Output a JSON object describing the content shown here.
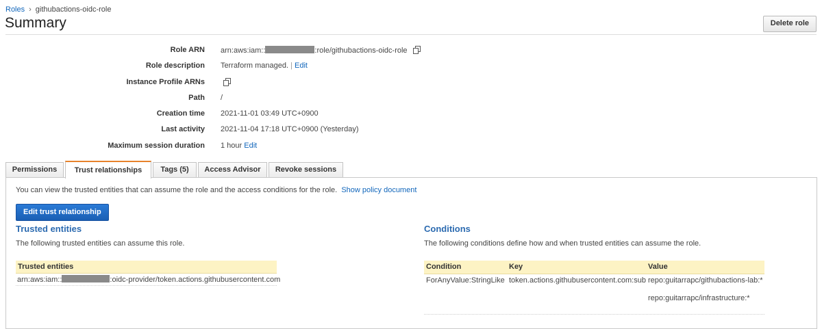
{
  "breadcrumb": {
    "root": "Roles",
    "separator": "›",
    "current": "githubactions-oidc-role"
  },
  "page_title": "Summary",
  "delete_button": "Delete role",
  "summary": {
    "role_arn": {
      "label": "Role ARN",
      "prefix": "arn:aws:iam::",
      "suffix": ":role/githubactions-oidc-role"
    },
    "role_description": {
      "label": "Role description",
      "value": "Terraform managed.",
      "divider": "|",
      "edit": "Edit"
    },
    "instance_profile": {
      "label": "Instance Profile ARNs"
    },
    "path": {
      "label": "Path",
      "value": "/"
    },
    "creation_time": {
      "label": "Creation time",
      "value": "2021-11-01 03:49 UTC+0900"
    },
    "last_activity": {
      "label": "Last activity",
      "value": "2021-11-04 17:18 UTC+0900 (Yesterday)"
    },
    "max_session": {
      "label": "Maximum session duration",
      "value": "1 hour",
      "edit": "Edit"
    }
  },
  "tabs": [
    {
      "label": "Permissions",
      "active": false
    },
    {
      "label": "Trust relationships",
      "active": true
    },
    {
      "label": "Tags (5)",
      "active": false
    },
    {
      "label": "Access Advisor",
      "active": false
    },
    {
      "label": "Revoke sessions",
      "active": false
    }
  ],
  "trust": {
    "intro": "You can view the trusted entities that can assume the role and the access conditions for the role.",
    "show_policy": "Show policy document",
    "edit_button": "Edit trust relationship",
    "entities": {
      "heading": "Trusted entities",
      "description": "The following trusted entities can assume this role.",
      "column": "Trusted entities",
      "row_prefix": "arn:aws:iam::",
      "row_suffix": ":oidc-provider/token.actions.githubusercontent.com"
    },
    "conditions": {
      "heading": "Conditions",
      "description": "The following conditions define how and when trusted entities can assume the role.",
      "columns": {
        "condition": "Condition",
        "key": "Key",
        "value": "Value"
      },
      "row": {
        "condition": "ForAnyValue:StringLike",
        "key": "token.actions.githubusercontent.com:sub",
        "values": [
          "repo:guitarrapc/githubactions-lab:*",
          "repo:guitarrapc/infrastructure:*"
        ]
      }
    }
  },
  "colors": {
    "accent_tab": "#e7822b",
    "link": "#1166bb",
    "primary_button": "#1a5fb4",
    "table_header": "#fdf3c4"
  }
}
